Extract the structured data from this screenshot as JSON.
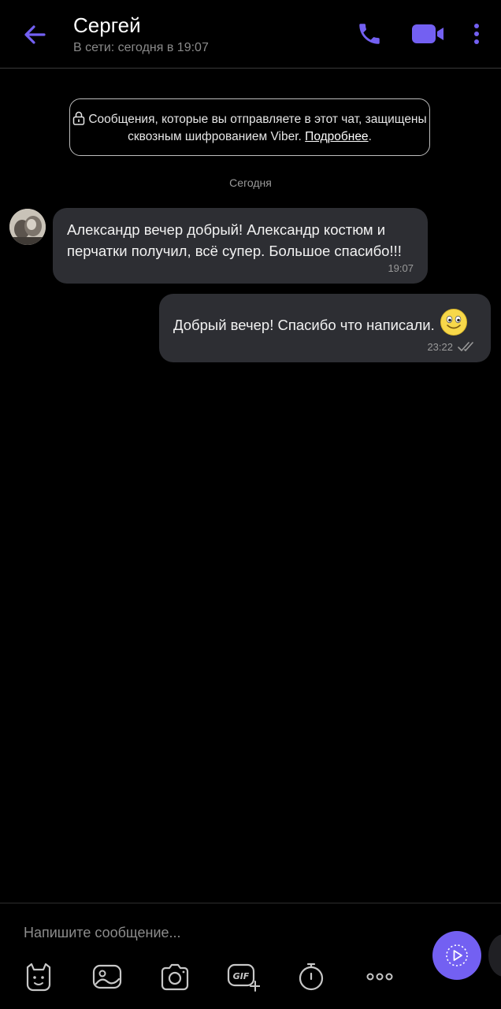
{
  "header": {
    "contact_name": "Сергей",
    "status": "В сети: сегодня в 19:07"
  },
  "encryption_notice": {
    "text": "Сообщения, которые вы отправляете в этот чат, защищены сквозным шифрованием Viber.",
    "more_link": "Подробнее",
    "end": "."
  },
  "date_separator": "Сегодня",
  "messages": [
    {
      "direction": "incoming",
      "text": "Александр вечер добрый! Александр костюм и перчатки получил, всё супер. Большое спасибо!!!",
      "time": "19:07"
    },
    {
      "direction": "outgoing",
      "text": "Добрый вечер! Спасибо что написали.",
      "emoji": "smiley",
      "time": "23:22",
      "status": "read"
    }
  ],
  "composer": {
    "placeholder": "Напишите сообщение..."
  },
  "toolbar": [
    "sticker-icon",
    "gallery-icon",
    "camera-icon",
    "gif-icon",
    "timer-icon",
    "more-icon"
  ],
  "colors": {
    "accent": "#7360f2",
    "bubble": "#2d2e33",
    "background": "#000000"
  }
}
